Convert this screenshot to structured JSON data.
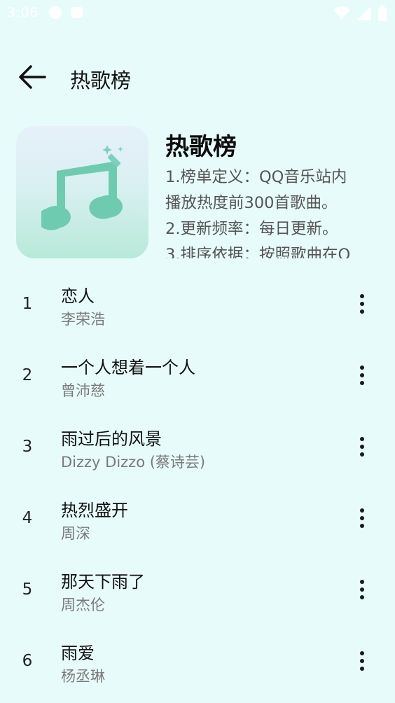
{
  "status_bar": {
    "time": "3:06",
    "icons": [
      "notification-dot-icon",
      "app-notification-icon",
      "wifi-icon",
      "signal-icon",
      "battery-icon"
    ]
  },
  "app_bar": {
    "back_icon": "arrow-left-icon",
    "title": "热歌榜"
  },
  "header": {
    "cover_icon": "music-note-icon",
    "title": "热歌榜",
    "description_lines": [
      "1.榜单定义：QQ音乐站内",
      "播放热度前300首歌曲。",
      "2.更新频率：每日更新。",
      "3.排序依据：按照歌曲在Q"
    ]
  },
  "songs": [
    {
      "rank": "1",
      "title": "恋人",
      "artist": "李荣浩"
    },
    {
      "rank": "2",
      "title": "一个人想着一个人",
      "artist": "曾沛慈"
    },
    {
      "rank": "3",
      "title": "雨过后的风景",
      "artist": "Dizzy Dizzo (蔡诗芸)"
    },
    {
      "rank": "4",
      "title": "热烈盛开",
      "artist": "周深"
    },
    {
      "rank": "5",
      "title": "那天下雨了",
      "artist": "周杰伦"
    },
    {
      "rank": "6",
      "title": "雨爱",
      "artist": "杨丞琳"
    }
  ],
  "colors": {
    "background": "#e7fbfa",
    "cover_gradient_top": "#e6f1fa",
    "cover_gradient_bottom": "#b8e9d8",
    "note_color": "#6fcbb0"
  }
}
